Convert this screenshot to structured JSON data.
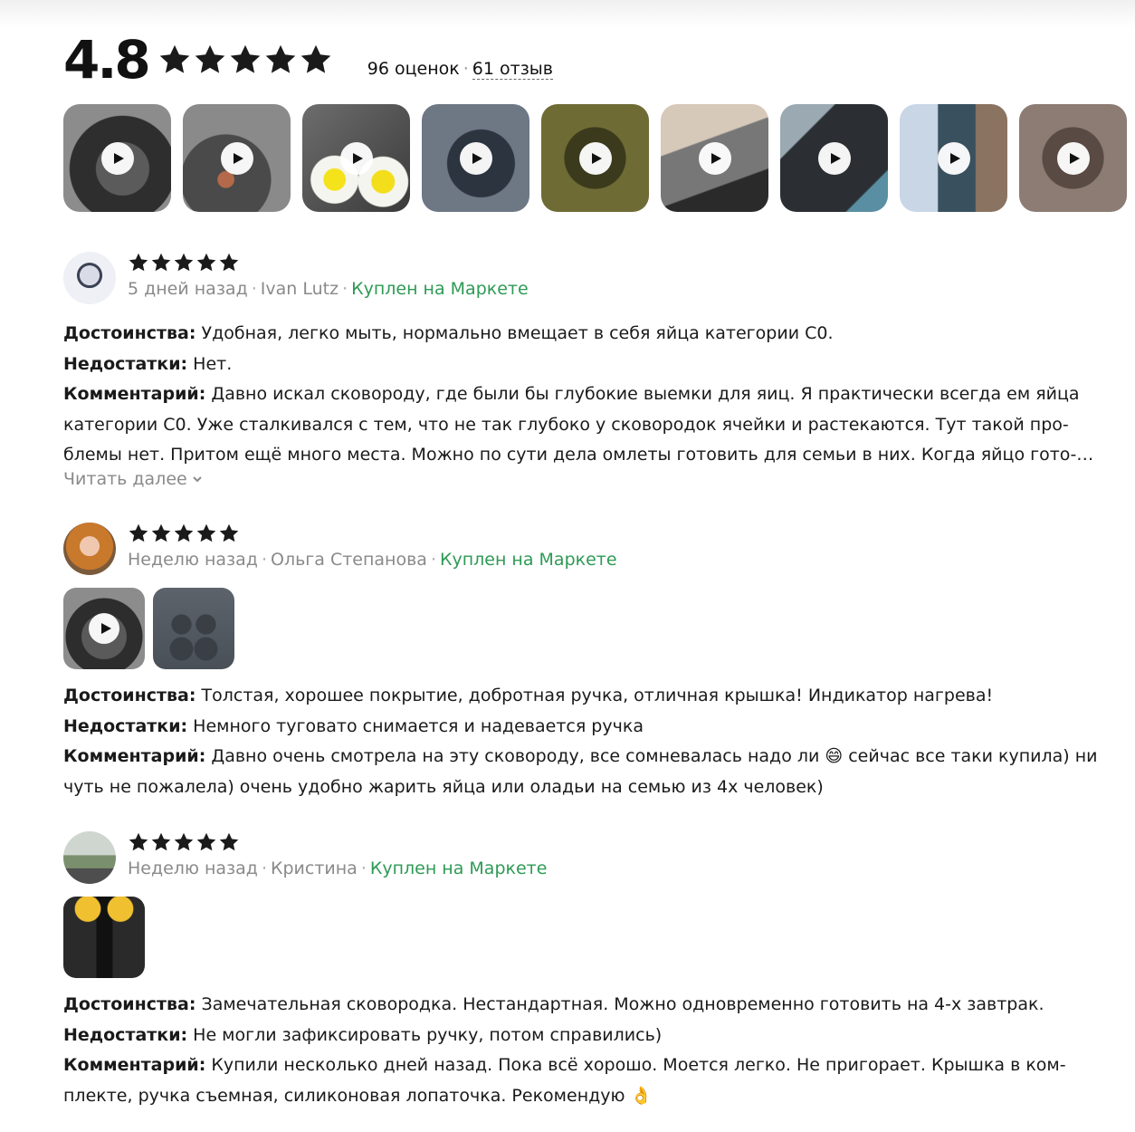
{
  "summary": {
    "rating": "4.8",
    "stars": 5,
    "ratings_count": "96 оценок",
    "separator": "·",
    "reviews_link": "61 отзыв"
  },
  "gallery": [
    {
      "video": true,
      "bg": "radial-gradient(circle at 55% 60%, #5b5b5b 0 30%, #2e2e2e 31% 60%, #8c8c8c 61%)"
    },
    {
      "video": true,
      "bg": "radial-gradient(circle at 40% 70%, #b46a4a 0 8%, #4a4a4a 9% 45%, #8a8a8a 46%)"
    },
    {
      "video": true,
      "bg": "radial-gradient(circle at 30% 70%, #f4e21a 0 10%, #f5f5f0 11% 22%, transparent 23%), radial-gradient(circle at 75% 72%, #f2de1a 0 10%, #f5f5f0 11% 22%, transparent 23%), linear-gradient(135deg,#6d6d6d,#3a3a3a)"
    },
    {
      "video": true,
      "bg": "radial-gradient(circle at 55% 55%, #2c3440 0 40%, #6e7784 41%)"
    },
    {
      "video": true,
      "bg": "radial-gradient(circle at 50% 50%, #3b3a1c 0 40%, #6e6b35 41%)"
    },
    {
      "video": true,
      "bg": "linear-gradient(160deg,#d6c9b9 0 35%,#777 36% 70%,#2a2a2a 71%)"
    },
    {
      "video": true,
      "bg": "linear-gradient(135deg,#9aa9b2 0 25%,#2b2f33 26% 80%,#5a8fa3 81%)"
    },
    {
      "video": true,
      "bg": "linear-gradient(90deg,#c9d6e6 0 35%,#39505f 36% 70%,#8a7360 71%)"
    },
    {
      "video": true,
      "bg": "radial-gradient(circle at 50% 50%, #5a4a44 0 40%, #8c7c73 41%)"
    }
  ],
  "reviews": [
    {
      "stars": 5,
      "avatar_bg": "radial-gradient(circle at 50% 45%, #d9dce6 0 25%, #3c4254 26% 32%, #eef0f5 33%)",
      "date": "5 дней назад",
      "dot": "·",
      "author": "Ivan Lutz",
      "dot2": "·",
      "bought": "Куплен на Маркете",
      "pros_label": "Достоинства:",
      "pros": "Удобная, легко мыть, нормально вмещает в себя яйца категории С0.",
      "cons_label": "Недостатки:",
      "cons": "Нет.",
      "comment_label": "Комментарий:",
      "comment": "Давно искал сковороду, где были бы глубокие выемки для яиц. Я практически всегда ем яйца категории С0. Уже сталкивался с тем, что не так глубоко у сковородок ячейки и растекаются. Тут такой про­блемы нет. Притом ещё много места. Можно по сути дела омлеты готовить для семьи в них. Когда яйцо гото­вится…",
      "read_more": "Читать далее"
    },
    {
      "stars": 5,
      "avatar_bg": "radial-gradient(circle at 50% 45%, #f0c8b0 0 25%, #c9792b 26% 60%, #7a5a3b 61%)",
      "date": "Неделю назад",
      "dot": "·",
      "author": "Ольга Степанова",
      "dot2": "·",
      "bought": "Куплен на Маркете",
      "photos": [
        {
          "video": true,
          "bg": "radial-gradient(circle at 50% 60%, #5a5a5a 0 35%, #2d2d2d 36% 60%, #8c8c8c 61%)"
        },
        {
          "video": false,
          "bg": "radial-gradient(circle at 35% 45%, #3a3f46 0 14%, transparent 15%), radial-gradient(circle at 65% 45%, #3a3f46 0 14%, transparent 15%), radial-gradient(circle at 35% 75%, #3a3f46 0 14%, transparent 15%), radial-gradient(circle at 65% 75%, #3a3f46 0 14%, transparent 15%), linear-gradient(#5c636b,#4a5057)"
        }
      ],
      "pros_label": "Достоинства:",
      "pros": "Толстая, хорошее покрытие, добротная ручка, отличная крышка! Индикатор нагрева!",
      "cons_label": "Недостатки:",
      "cons": "Немного туговато снимается и надевается ручка",
      "comment_label": "Комментарий:",
      "comment": "Давно очень смотрела на эту сковороду, все сомневалась надо ли 😄 сейчас все таки купила) ни чуть не пожалела) очень удобно жарить яйца или оладьи на семью из 4х человек)"
    },
    {
      "stars": 5,
      "avatar_bg": "linear-gradient(#cfd6cf 0 45%,#7a8f6e 46% 70%,#4e4e4e 71%)",
      "date": "Неделю назад",
      "dot": "·",
      "author": "Кристина",
      "dot2": "·",
      "bought": "Куплен на Маркете",
      "photos": [
        {
          "video": false,
          "bg": "radial-gradient(circle at 30% 15%, #f0c030 0 14%, transparent 15%), radial-gradient(circle at 70% 15%, #f0c030 0 14%, transparent 15%), linear-gradient(90deg,#2a2a2a 0 40%,#111 41% 60%,#2a2a2a 61%)"
        }
      ],
      "pros_label": "Достоинства:",
      "pros": "Замечательная сковородка. Нестандартная. Можно одновременно готовить на 4-х завтрак.",
      "cons_label": "Недостатки:",
      "cons": "Не могли зафиксировать ручку, потом справились)",
      "comment_label": "Комментарий:",
      "comment": "Купили несколько дней назад. Пока всё хорошо. Моется легко. Не пригорает. Крышка в ком­плекте, ручка съемная, силиконовая лопаточка. Рекомендую 👌"
    }
  ]
}
